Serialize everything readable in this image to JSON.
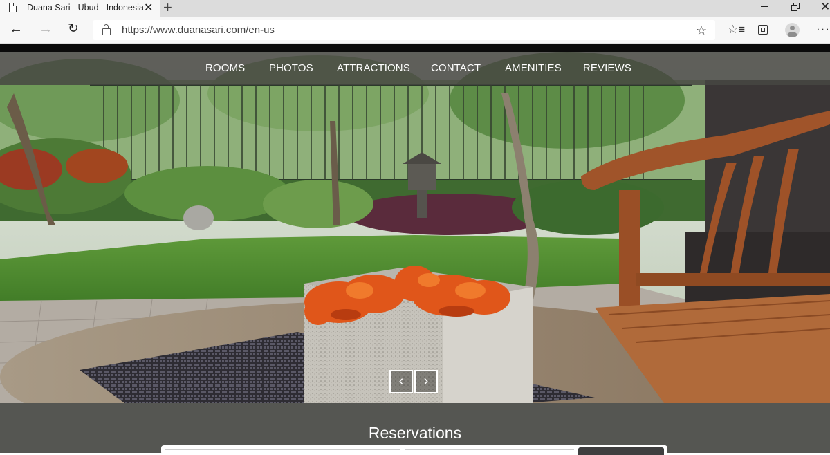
{
  "browser": {
    "tab_title": "Duana Sari - Ubud - Indonesia",
    "tab_close": "✕",
    "new_tab": "+",
    "url": "https://www.duanasari.com/en-us",
    "icons": [
      "page-icon",
      "close-icon",
      "plus-icon",
      "minimize-icon",
      "maximize-icon",
      "close-window-icon",
      "back-arrow-icon",
      "forward-arrow-icon",
      "refresh-icon",
      "lock-icon",
      "star-icon",
      "favorites-icon",
      "collections-icon",
      "profile-icon",
      "more-icon"
    ]
  },
  "nav": {
    "items": [
      {
        "label": "ROOMS"
      },
      {
        "label": "PHOTOS"
      },
      {
        "label": "ATTRACTIONS"
      },
      {
        "label": "CONTACT"
      },
      {
        "label": "AMENITIES"
      },
      {
        "label": "REVIEWS"
      }
    ]
  },
  "carousel": {
    "prev_symbol": "‹",
    "next_symbol": "›"
  },
  "reservations": {
    "title": "Reservations"
  },
  "colors": {
    "nav_bg": "#464642",
    "reservations_bg": "#555652",
    "flower": "#e0561a",
    "lawn": "#4f8a2e"
  }
}
